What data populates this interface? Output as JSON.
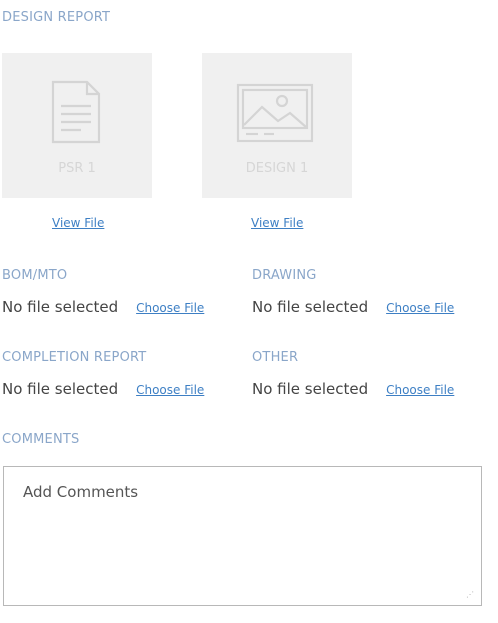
{
  "design_report": {
    "heading": "DESIGN REPORT",
    "files": [
      {
        "caption": "PSR 1",
        "icon": "document-icon",
        "view_label": "View File"
      },
      {
        "caption": "DESIGN 1",
        "icon": "image-icon",
        "view_label": "View File"
      }
    ]
  },
  "uploads": {
    "bom_mto": {
      "label": "BOM/MTO",
      "status": "No file selected",
      "button": "Choose File"
    },
    "drawing": {
      "label": "DRAWING",
      "status": "No file selected",
      "button": "Choose File"
    },
    "completion_report": {
      "label": "COMPLETION REPORT",
      "status": "No file selected",
      "button": "Choose File"
    },
    "other": {
      "label": "OTHER",
      "status": "No file selected",
      "button": "Choose File"
    }
  },
  "comments": {
    "heading": "COMMENTS",
    "placeholder": "Add Comments",
    "value": ""
  },
  "colors": {
    "label": "#8aa6c9",
    "link": "#3d7fc4",
    "thumb_bg": "#f0f0f0",
    "icon": "#d4d4d4"
  }
}
